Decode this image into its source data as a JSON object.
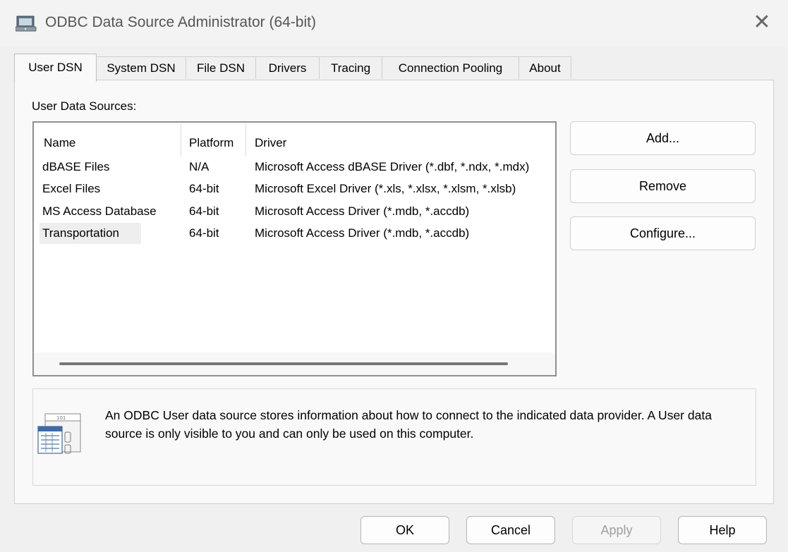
{
  "window": {
    "title": "ODBC Data Source Administrator (64-bit)",
    "close_glyph": "✕"
  },
  "tabs": [
    {
      "label": "User DSN",
      "active": true
    },
    {
      "label": "System DSN"
    },
    {
      "label": "File DSN"
    },
    {
      "label": "Drivers"
    },
    {
      "label": "Tracing"
    },
    {
      "label": "Connection Pooling"
    },
    {
      "label": "About"
    }
  ],
  "section_label": "User Data Sources:",
  "list": {
    "columns": [
      "Name",
      "Platform",
      "Driver"
    ],
    "rows": [
      {
        "name": "dBASE Files",
        "platform": "N/A",
        "driver": "Microsoft Access dBASE Driver (*.dbf, *.ndx, *.mdx)"
      },
      {
        "name": "Excel Files",
        "platform": "64-bit",
        "driver": "Microsoft Excel Driver (*.xls, *.xlsx, *.xlsm, *.xlsb)"
      },
      {
        "name": "MS Access Database",
        "platform": "64-bit",
        "driver": "Microsoft Access Driver (*.mdb, *.accdb)"
      },
      {
        "name": "Transportation",
        "platform": "64-bit",
        "driver": "Microsoft Access Driver (*.mdb, *.accdb)",
        "selected": true
      }
    ]
  },
  "side_buttons": {
    "add": "Add...",
    "remove": "Remove",
    "configure": "Configure..."
  },
  "info": {
    "text": "An ODBC User data source stores information about how to connect to the indicated data provider.   A User data source is only visible to you and can only be used on this computer."
  },
  "footer": {
    "ok": "OK",
    "cancel": "Cancel",
    "apply": "Apply",
    "help": "Help"
  },
  "icons": {
    "app": "odbc-app-icon",
    "close": "close-icon",
    "info": "datasource-info-icon"
  }
}
